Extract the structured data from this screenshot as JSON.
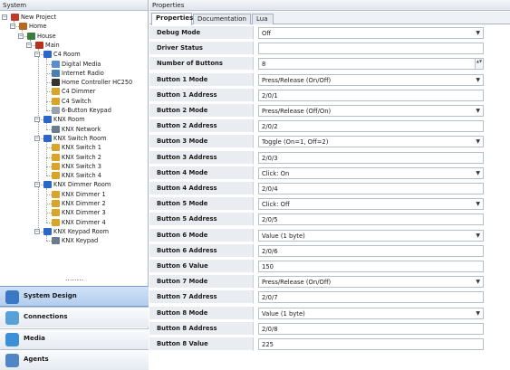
{
  "left_panel": {
    "title": "System",
    "tree": [
      {
        "label": "New Project",
        "depth": 0,
        "icon": "project-icon",
        "color": "#c0392b"
      },
      {
        "label": "Home",
        "depth": 1,
        "icon": "home-icon",
        "color": "#b56a1f"
      },
      {
        "label": "House",
        "depth": 2,
        "icon": "house-icon",
        "color": "#3a7d3a"
      },
      {
        "label": "Main",
        "depth": 3,
        "icon": "floor-icon",
        "color": "#b5331c"
      },
      {
        "label": "C4 Room",
        "depth": 4,
        "icon": "room-icon",
        "color": "#2c66c9"
      },
      {
        "label": "Digital Media",
        "depth": 5,
        "icon": "media-icon",
        "color": "#5a8fcf"
      },
      {
        "label": "Internet Radio",
        "depth": 5,
        "icon": "radio-icon",
        "color": "#4a7fb8"
      },
      {
        "label": "Home Controller HC250",
        "depth": 5,
        "icon": "controller-icon",
        "color": "#333333"
      },
      {
        "label": "C4 Dimmer",
        "depth": 5,
        "icon": "dimmer-icon",
        "color": "#d9a428"
      },
      {
        "label": "C4 Switch",
        "depth": 5,
        "icon": "switch-icon",
        "color": "#d9a428"
      },
      {
        "label": "6-Button Keypad",
        "depth": 5,
        "icon": "keypad-icon",
        "color": "#9aa3ad"
      },
      {
        "label": "KNX Room",
        "depth": 4,
        "icon": "room-icon",
        "color": "#2c66c9"
      },
      {
        "label": "KNX Network",
        "depth": 5,
        "icon": "network-icon",
        "color": "#6a7c8e"
      },
      {
        "label": "KNX Switch Room",
        "depth": 4,
        "icon": "room-icon",
        "color": "#2c66c9"
      },
      {
        "label": "KNX Switch 1",
        "depth": 5,
        "icon": "switch-icon",
        "color": "#d9a428"
      },
      {
        "label": "KNX Switch 2",
        "depth": 5,
        "icon": "switch-icon",
        "color": "#d9a428"
      },
      {
        "label": "KNX Switch 3",
        "depth": 5,
        "icon": "switch-icon",
        "color": "#d9a428"
      },
      {
        "label": "KNX Switch 4",
        "depth": 5,
        "icon": "switch-icon",
        "color": "#d9a428"
      },
      {
        "label": "KNX Dimmer Room",
        "depth": 4,
        "icon": "room-icon",
        "color": "#2c66c9"
      },
      {
        "label": "KNX Dimmer 1",
        "depth": 5,
        "icon": "dimmer-icon",
        "color": "#d9a428"
      },
      {
        "label": "KNX Dimmer 2",
        "depth": 5,
        "icon": "dimmer-icon",
        "color": "#d9a428"
      },
      {
        "label": "KNX Dimmer 3",
        "depth": 5,
        "icon": "dimmer-icon",
        "color": "#d9a428"
      },
      {
        "label": "KNX Dimmer 4",
        "depth": 5,
        "icon": "dimmer-icon",
        "color": "#d9a428"
      },
      {
        "label": "KNX Keypad Room",
        "depth": 4,
        "icon": "room-icon",
        "color": "#2c66c9"
      },
      {
        "label": "KNX Keypad",
        "depth": 5,
        "icon": "keypad-icon",
        "color": "#6a7c8e"
      }
    ],
    "splitter": "........",
    "nav_buttons": [
      {
        "label": "System Design",
        "icon": "system-design-icon",
        "color": "#3b78c4",
        "selected": true
      },
      {
        "label": "Connections",
        "icon": "connections-icon",
        "color": "#5aa0d8",
        "selected": false
      },
      {
        "label": "Media",
        "icon": "media-icon",
        "color": "#3e8fd6",
        "selected": false
      },
      {
        "label": "Agents",
        "icon": "agents-icon",
        "color": "#4f86c6",
        "selected": false
      }
    ]
  },
  "right_panel": {
    "title": "Properties",
    "tabs": [
      {
        "label": "Properties",
        "active": true
      },
      {
        "label": "Documentation",
        "active": false
      },
      {
        "label": "Lua",
        "active": false
      }
    ],
    "properties": [
      {
        "label": "Debug Mode",
        "value": "Off",
        "type": "combo"
      },
      {
        "label": "Driver Status",
        "value": "",
        "type": "text"
      },
      {
        "label": "Number of Buttons",
        "value": "8",
        "type": "spin"
      },
      {
        "label": "Button 1 Mode",
        "value": "Press/Release (On/Off)",
        "type": "combo"
      },
      {
        "label": "Button 1 Address",
        "value": "2/0/1",
        "type": "text"
      },
      {
        "label": "Button 2 Mode",
        "value": "Press/Release (Off/On)",
        "type": "combo"
      },
      {
        "label": "Button 2 Address",
        "value": "2/0/2",
        "type": "text"
      },
      {
        "label": "Button 3 Mode",
        "value": "Toggle (On=1, Off=2)",
        "type": "combo"
      },
      {
        "label": "Button 3 Address",
        "value": "2/0/3",
        "type": "text"
      },
      {
        "label": "Button 4 Mode",
        "value": "Click: On",
        "type": "combo"
      },
      {
        "label": "Button 4 Address",
        "value": "2/0/4",
        "type": "text"
      },
      {
        "label": "Button 5 Mode",
        "value": "Click: Off",
        "type": "combo"
      },
      {
        "label": "Button 5 Address",
        "value": "2/0/5",
        "type": "text"
      },
      {
        "label": "Button 6 Mode",
        "value": "Value (1 byte)",
        "type": "combo"
      },
      {
        "label": "Button 6 Address",
        "value": "2/0/6",
        "type": "text"
      },
      {
        "label": "Button 6 Value",
        "value": "150",
        "type": "text"
      },
      {
        "label": "Button 7 Mode",
        "value": "Press/Release (On/Off)",
        "type": "combo"
      },
      {
        "label": "Button 7 Address",
        "value": "2/0/7",
        "type": "text"
      },
      {
        "label": "Button 8 Mode",
        "value": "Value (1 byte)",
        "type": "combo"
      },
      {
        "label": "Button 8 Address",
        "value": "2/0/8",
        "type": "text"
      },
      {
        "label": "Button 8 Value",
        "value": "225",
        "type": "text"
      }
    ]
  }
}
